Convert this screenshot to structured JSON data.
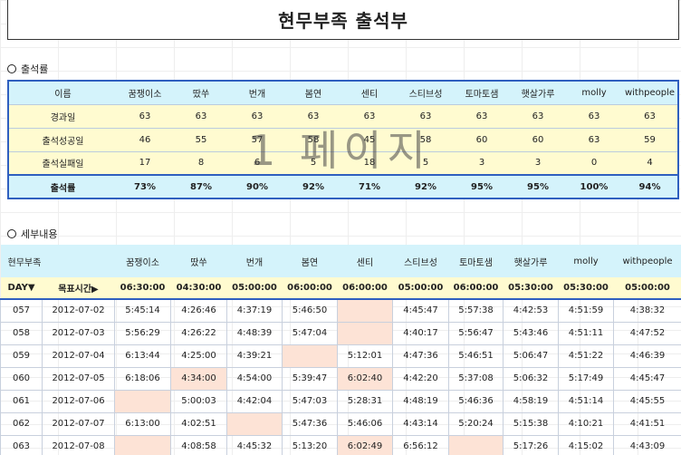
{
  "title": "현무부족 출석부",
  "section1": "출석률",
  "section2": "세부내용",
  "watermark": "1 페이지",
  "summary": {
    "header": [
      "이름",
      "꿈쟁이소",
      "땄쑤",
      "번개",
      "봄연",
      "센티",
      "스티브성",
      "토마토샘",
      "햇살가루",
      "molly",
      "withpeople"
    ],
    "rows": [
      [
        "경과일",
        "63",
        "63",
        "63",
        "63",
        "63",
        "63",
        "63",
        "63",
        "63",
        "63"
      ],
      [
        "출석성공일",
        "46",
        "55",
        "57",
        "58",
        "45",
        "58",
        "60",
        "60",
        "63",
        "59"
      ],
      [
        "출석실패일",
        "17",
        "8",
        "6",
        "5",
        "18",
        "5",
        "3",
        "3",
        "0",
        "4"
      ]
    ],
    "total": [
      "출석률",
      "73%",
      "87%",
      "90%",
      "92%",
      "71%",
      "92%",
      "95%",
      "95%",
      "100%",
      "94%"
    ]
  },
  "detail": {
    "header": [
      "현무부족",
      "",
      "꿈쟁이소",
      "땄쑤",
      "번개",
      "봄연",
      "센티",
      "스티브성",
      "토마토샘",
      "햇살가루",
      "molly",
      "withpeople"
    ],
    "target": [
      "DAY▼",
      "목표시간▶",
      "06:30:00",
      "04:30:00",
      "05:00:00",
      "06:00:00",
      "06:00:00",
      "05:00:00",
      "06:00:00",
      "05:30:00",
      "05:30:00",
      "05:00:00"
    ],
    "rows": [
      [
        "057",
        "2012-07-02",
        "5:45:14",
        "4:26:46",
        "4:37:19",
        "5:46:50",
        "",
        "4:45:47",
        "5:57:38",
        "4:42:53",
        "4:51:59",
        "4:38:32"
      ],
      [
        "058",
        "2012-07-03",
        "5:56:29",
        "4:26:22",
        "4:48:39",
        "5:47:04",
        "",
        "4:40:17",
        "5:56:47",
        "5:43:46",
        "4:51:11",
        "4:47:52"
      ],
      [
        "059",
        "2012-07-04",
        "6:13:44",
        "4:25:00",
        "4:39:21",
        "",
        "5:12:01",
        "4:47:36",
        "5:46:51",
        "5:06:47",
        "4:51:22",
        "4:46:39"
      ],
      [
        "060",
        "2012-07-05",
        "6:18:06",
        "4:34:00",
        "4:54:00",
        "5:39:47",
        "6:02:40",
        "4:42:20",
        "5:37:08",
        "5:06:32",
        "5:17:49",
        "4:45:47"
      ],
      [
        "061",
        "2012-07-06",
        "",
        "5:00:03",
        "4:42:04",
        "5:47:03",
        "5:28:31",
        "4:48:19",
        "5:46:36",
        "4:58:19",
        "4:51:14",
        "4:45:55"
      ],
      [
        "062",
        "2012-07-07",
        "6:13:00",
        "4:02:51",
        "",
        "5:47:36",
        "5:46:06",
        "4:43:14",
        "5:20:24",
        "5:15:38",
        "4:10:21",
        "4:41:51"
      ],
      [
        "063",
        "2012-07-08",
        "",
        "4:08:58",
        "4:45:32",
        "5:13:20",
        "6:02:49",
        "6:56:12",
        "",
        "5:17:26",
        "4:15:02",
        "4:43:09"
      ]
    ],
    "shaded": [
      [
        6
      ],
      [
        6
      ],
      [
        5
      ],
      [
        3,
        6
      ],
      [
        2
      ],
      [
        4
      ],
      [
        2,
        6,
        8
      ]
    ]
  }
}
